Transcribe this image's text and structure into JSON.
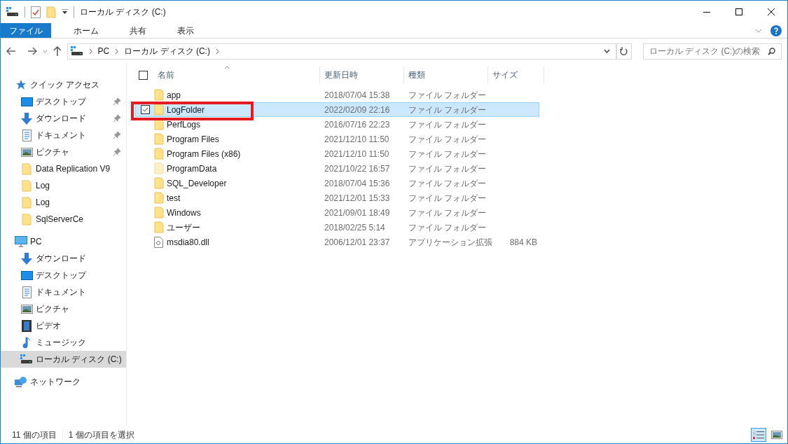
{
  "window": {
    "title": "ローカル ディスク (C:)"
  },
  "ribbon_tabs": [
    {
      "label": "ファイル",
      "selected": true
    },
    {
      "label": "ホーム",
      "selected": false
    },
    {
      "label": "共有",
      "selected": false
    },
    {
      "label": "表示",
      "selected": false
    }
  ],
  "address": {
    "crumbs": [
      "PC",
      "ローカル ディスク (C:)"
    ]
  },
  "search": {
    "placeholder": "ローカル ディスク (C:)の検索"
  },
  "sidebar": {
    "sections": [
      {
        "label": "クイック アクセス",
        "kind": "star",
        "selected": false,
        "children": [
          {
            "label": "デスクトップ",
            "kind": "desktop",
            "pinned": true,
            "selected": false
          },
          {
            "label": "ダウンロード",
            "kind": "download",
            "pinned": true,
            "selected": false
          },
          {
            "label": "ドキュメント",
            "kind": "document",
            "pinned": true,
            "selected": false
          },
          {
            "label": "ピクチャ",
            "kind": "picture",
            "pinned": true,
            "selected": false
          },
          {
            "label": "Data Replication V9",
            "kind": "folder",
            "pinned": false,
            "selected": false
          },
          {
            "label": "Log",
            "kind": "folder",
            "pinned": false,
            "selected": false
          },
          {
            "label": "Log",
            "kind": "folder",
            "pinned": false,
            "selected": false
          },
          {
            "label": "SqlServerCe",
            "kind": "folder",
            "pinned": false,
            "selected": false
          }
        ]
      },
      {
        "label": "PC",
        "kind": "pc",
        "selected": false,
        "children": [
          {
            "label": "ダウンロード",
            "kind": "download",
            "pinned": false,
            "selected": false
          },
          {
            "label": "デスクトップ",
            "kind": "desktop",
            "pinned": false,
            "selected": false
          },
          {
            "label": "ドキュメント",
            "kind": "document",
            "pinned": false,
            "selected": false
          },
          {
            "label": "ピクチャ",
            "kind": "picture",
            "pinned": false,
            "selected": false
          },
          {
            "label": "ビデオ",
            "kind": "video",
            "pinned": false,
            "selected": false
          },
          {
            "label": "ミュージック",
            "kind": "music",
            "pinned": false,
            "selected": false
          },
          {
            "label": "ローカル ディスク (C:)",
            "kind": "drive",
            "pinned": false,
            "selected": true
          }
        ]
      },
      {
        "label": "ネットワーク",
        "kind": "network",
        "selected": false
      }
    ]
  },
  "table": {
    "select_all": {
      "checked": false
    },
    "columns": [
      "名前",
      "更新日時",
      "種類",
      "サイズ"
    ],
    "rows": [
      {
        "name": "app",
        "date": "2018/07/04 15:38",
        "type": "ファイル フォルダー",
        "kind": "folder",
        "selected": false,
        "checked": false
      },
      {
        "name": "LogFolder",
        "date": "2022/02/09 22:16",
        "type": "ファイル フォルダー",
        "kind": "folder",
        "selected": true,
        "checked": true
      },
      {
        "name": "PerfLogs",
        "date": "2016/07/16 22:23",
        "type": "ファイル フォルダー",
        "kind": "folder",
        "selected": false,
        "checked": false
      },
      {
        "name": "Program Files",
        "date": "2021/12/10 11:50",
        "type": "ファイル フォルダー",
        "kind": "folder",
        "selected": false,
        "checked": false
      },
      {
        "name": "Program Files (x86)",
        "date": "2021/12/10 11:50",
        "type": "ファイル フォルダー",
        "kind": "folder",
        "selected": false,
        "checked": false
      },
      {
        "name": "ProgramData",
        "date": "2021/10/22 16:57",
        "type": "ファイル フォルダー",
        "kind": "hidden-folder",
        "selected": false,
        "checked": false
      },
      {
        "name": "SQL_Developer",
        "date": "2018/07/04 15:36",
        "type": "ファイル フォルダー",
        "kind": "folder",
        "selected": false,
        "checked": false
      },
      {
        "name": "test",
        "date": "2021/12/01 15:33",
        "type": "ファイル フォルダー",
        "kind": "folder",
        "selected": false,
        "checked": false
      },
      {
        "name": "Windows",
        "date": "2021/09/01 18:49",
        "type": "ファイル フォルダー",
        "kind": "folder",
        "selected": false,
        "checked": false
      },
      {
        "name": "ユーザー",
        "date": "2018/02/25 5:14",
        "type": "ファイル フォルダー",
        "kind": "folder",
        "selected": false,
        "checked": false
      },
      {
        "name": "msdia80.dll",
        "date": "2006/12/01 23:37",
        "type": "アプリケーション拡張",
        "size": "884 KB",
        "kind": "file",
        "selected": false,
        "checked": false
      }
    ]
  },
  "status_bar": {
    "item_count": "11 個の項目",
    "selection": "1 個の項目を選択"
  }
}
